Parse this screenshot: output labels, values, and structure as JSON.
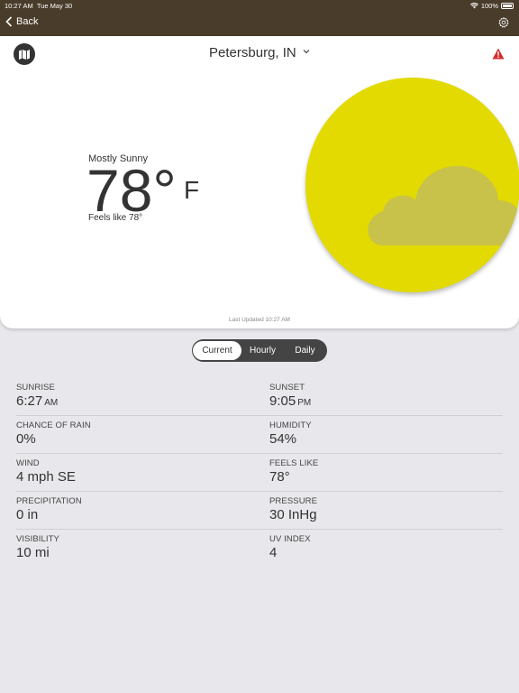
{
  "status": {
    "time": "10:27 AM",
    "date": "Tue May 30",
    "battery": "100%"
  },
  "nav": {
    "back_label": "Back"
  },
  "location": {
    "name": "Petersburg, IN"
  },
  "current": {
    "condition": "Mostly Sunny",
    "temp": "78°",
    "unit": "F",
    "feels_like": "Feels like 78°",
    "last_updated": "Last Updated 10:27 AM"
  },
  "tabs": [
    {
      "label": "Current",
      "active": true
    },
    {
      "label": "Hourly",
      "active": false
    },
    {
      "label": "Daily",
      "active": false
    }
  ],
  "details": [
    {
      "left": {
        "label": "SUNRISE",
        "value": "6:27",
        "suffix": "AM"
      },
      "right": {
        "label": "SUNSET",
        "value": "9:05",
        "suffix": "PM"
      }
    },
    {
      "left": {
        "label": "CHANCE OF RAIN",
        "value": "0%"
      },
      "right": {
        "label": "HUMIDITY",
        "value": "54%"
      }
    },
    {
      "left": {
        "label": "WIND",
        "value": "4 mph SE"
      },
      "right": {
        "label": "FEELS LIKE",
        "value": "78°"
      }
    },
    {
      "left": {
        "label": "PRECIPITATION",
        "value": "0 in"
      },
      "right": {
        "label": "PRESSURE",
        "value": "30 InHg"
      }
    },
    {
      "left": {
        "label": "VISIBILITY",
        "value": "10 mi"
      },
      "right": {
        "label": "UV INDEX",
        "value": "4"
      }
    }
  ],
  "colors": {
    "header": "#4a3c2a",
    "sun": "#e2da00",
    "alert": "#d32f2f",
    "background": "#e8e8ec"
  },
  "icons": {
    "map": "map-icon",
    "gear": "gear-icon",
    "alert": "warning-icon",
    "wifi": "wifi-icon",
    "battery": "battery-icon"
  }
}
